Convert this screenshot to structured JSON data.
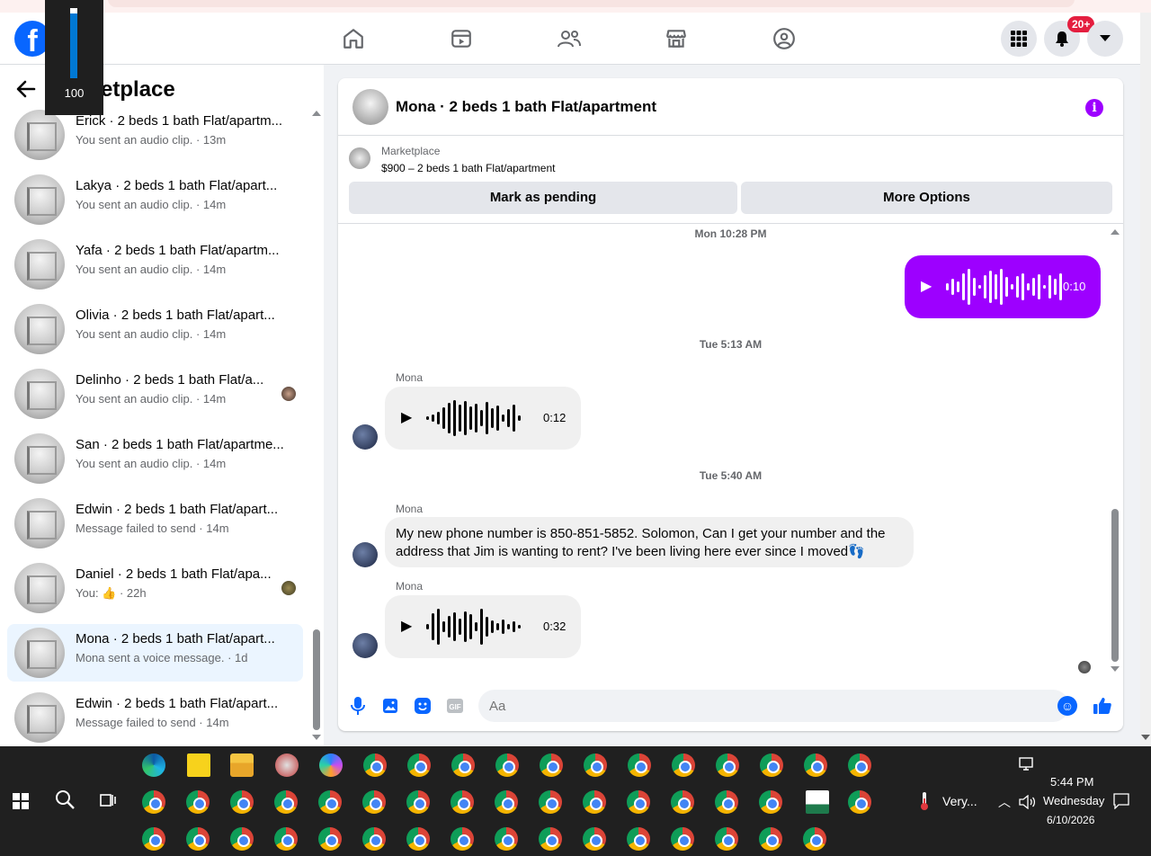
{
  "volume": {
    "value": "100"
  },
  "nav": {
    "notifications_badge": "20+"
  },
  "sidebar": {
    "title": "Marketplace",
    "conversations": [
      {
        "name": "Erick · 2 beds 1 bath Flat/apartm...",
        "sub": "You sent an audio clip. · 13m"
      },
      {
        "name": "Lakya · 2 beds 1 bath Flat/apart...",
        "sub": "You sent an audio clip. · 14m"
      },
      {
        "name": "Yafa · 2 beds 1 bath Flat/apartm...",
        "sub": "You sent an audio clip. · 14m"
      },
      {
        "name": "Olivia · 2 beds 1 bath Flat/apart...",
        "sub": "You sent an audio clip. · 14m"
      },
      {
        "name": "Delinho · 2 beds 1 bath Flat/a...",
        "sub": "You sent an audio clip. · 14m"
      },
      {
        "name": "San · 2 beds 1 bath Flat/apartme...",
        "sub": "You sent an audio clip. · 14m"
      },
      {
        "name": "Edwin · 2 beds 1 bath Flat/apart...",
        "sub": "Message failed to send · 14m"
      },
      {
        "name": "Daniel · 2 beds 1 bath Flat/apa...",
        "sub": "You: 👍 · 22h"
      },
      {
        "name": "Mona · 2 beds 1 bath Flat/apart...",
        "sub": "Mona sent a voice message. · 1d"
      },
      {
        "name": "Edwin · 2 beds 1 bath Flat/apart...",
        "sub": "Message failed to send · 14m"
      }
    ]
  },
  "chat": {
    "title": "Mona · 2 beds 1 bath Flat/apartment",
    "listing_category": "Marketplace",
    "listing_price": "$900 – 2 beds 1 bath Flat/apartment",
    "mark_pending_label": "Mark as pending",
    "more_options_label": "More Options",
    "messages": {
      "ts1": "Mon 10:28 PM",
      "out_audio_duration": "0:10",
      "ts2": "Tue 5:13 AM",
      "sender1": "Mona",
      "in_audio1_duration": "0:12",
      "ts3": "Tue 5:40 AM",
      "sender2": "Mona",
      "text1": "My new phone number is 850-851-5852. Solomon, Can I get your number and the address that Jim is wanting to rent? I've been living here ever since I moved👣",
      "sender3": "Mona",
      "in_audio2_duration": "0:32"
    },
    "composer_placeholder": "Aa"
  },
  "taskbar": {
    "weather": "Very...",
    "time": "5:44 PM",
    "day": "Wednesday",
    "date": "6/10/2026"
  }
}
